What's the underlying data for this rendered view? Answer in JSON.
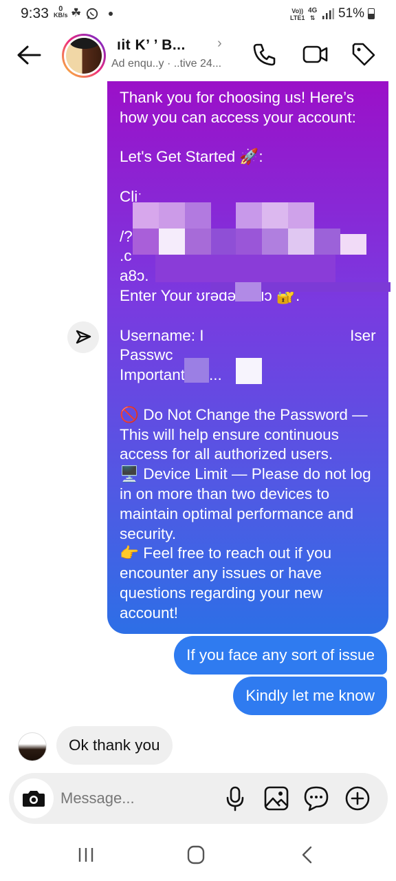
{
  "status_bar": {
    "time": "9:33",
    "data_rate_value": "0",
    "data_rate_unit": "KB/s",
    "volte_top": "Vo))",
    "volte_bottom": "LTE1",
    "network": "4G",
    "battery": "51%"
  },
  "header": {
    "contact_name": "ıit K’  ’  B...",
    "contact_subtitle": "Ad enqu..y · ..tive 24...",
    "icons": [
      "back-arrow-icon",
      "phone-icon",
      "video-icon",
      "tag-icon"
    ]
  },
  "messages": {
    "outgoing_main": {
      "intro": "Thank you for choosing us! Here’s how you can access your account:",
      "get_started": "Let's Get Started 🚀:",
      "redacted_block": "Cliˑ\n                                    ugnin\n/?in\n.c\na8ɔ.                                       /\nEnter Your ʊrədəntiɑlɔ 🔐.",
      "credentials_block": "Username: I                                  Iser\nPasswc\nImportant No...",
      "note1": "🚫 Do Not Change the Password — This will help ensure continuous access for all authorized users.",
      "note2": "🖥️ Device Limit — Please do not log in on more than two devices to maintain optimal performance and security.",
      "note3": "👉 Feel free to reach out if you encounter any issues or have questions regarding your new account!"
    },
    "outgoing_1": "If you face any sort of issue",
    "outgoing_2": "Kindly let me know",
    "incoming_1": "Ok thank you"
  },
  "composer": {
    "placeholder": "Message...",
    "icons": [
      "camera-icon",
      "microphone-icon",
      "gallery-icon",
      "sticker-icon",
      "plus-icon"
    ]
  },
  "colors": {
    "bubble_top": "#9b10c8",
    "bubble_bottom": "#2d6fe6",
    "blue_bubble": "#2f7bf0",
    "grey_bubble": "#efefef"
  }
}
